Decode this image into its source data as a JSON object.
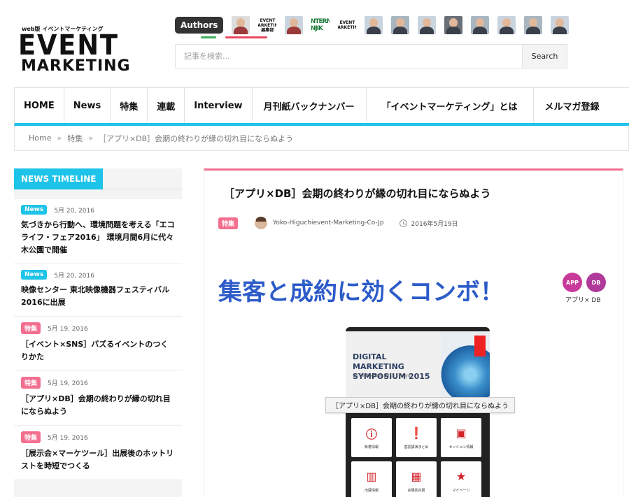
{
  "logo": {
    "tagline": "web版 イベントマーケティング",
    "line1": "EVENT",
    "line2": "MARKETING"
  },
  "authors": {
    "label": "Authors",
    "logo_small_1": "EVENT MARKETING 編集部",
    "logo_small_2": "EVENT MARKETING",
    "green_text": "NTERN NJIK"
  },
  "search": {
    "placeholder": "記事を検索...",
    "button": "Search"
  },
  "nav": {
    "items": [
      "HOME",
      "News",
      "特集",
      "連載",
      "Interview",
      "月刊紙バックナンバー",
      "「イベントマーケティング」とは",
      "メルマガ登録"
    ]
  },
  "breadcrumb": {
    "home": "Home",
    "sep": "»",
    "category": "特集",
    "current": "［アプリ×DB］会期の終わりが縁の切れ目にならぬよう"
  },
  "sidebar": {
    "heading": "NEWS TIMELINE",
    "items": [
      {
        "badge": "News",
        "date": "5月 20, 2016",
        "title": "気づきから行動へ、環境問題を考える「エコライフ・フェア2016」 環境月間6月に代々木公園で開催"
      },
      {
        "badge": "News",
        "date": "5月 20, 2016",
        "title": "映像センター 東北映像機器フェスティバル2016に出展"
      },
      {
        "badge": "特集",
        "date": "5月 19, 2016",
        "title": "［イベント×SNS］バズるイベントのつくりかた"
      },
      {
        "badge": "特集",
        "date": "5月 19, 2016",
        "title": "［アプリ×DB］会期の終わりが縁の切れ目にならぬよう"
      },
      {
        "badge": "特集",
        "date": "5月 19, 2016",
        "title": "［展示会×マーケツール］出展後のホットリストを時短でつくる"
      }
    ]
  },
  "article": {
    "title": "［アプリ×DB］会期の終わりが縁の切れ目にならぬよう",
    "category": "特集",
    "author": "Yoko-Higuchievent-Marketing-Co-Jp",
    "date": "2016年5月19日",
    "headline": "集客と成約に効くコンボ！",
    "badge_app": "APP",
    "badge_db": "DB",
    "badge_caption": "アプリ× DB",
    "phone": {
      "title": "DIGITAL MARKETING SYMPOSIUM 2015",
      "subtitle": "15 September 2015 | Tokyo",
      "tiles": [
        "新着情報",
        "基調講演まとめ",
        "セッション情報",
        "出展情報",
        "会場案内図",
        "マイページ"
      ]
    },
    "tooltip": "［アプリ×DB］会期の終わりが縁の切れ目にならぬよう"
  },
  "colors": {
    "accent_cyan": "#1dc3e8",
    "accent_pink": "#f36f8f",
    "headline_blue": "#2d5cc9"
  }
}
